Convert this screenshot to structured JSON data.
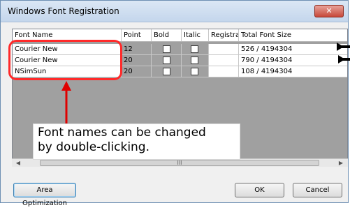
{
  "window": {
    "title": "Windows Font Registration",
    "close_glyph": "✕"
  },
  "table": {
    "headers": [
      "Font Name",
      "Point",
      "Bold",
      "Italic",
      "Registrati",
      "Total Font Size"
    ],
    "rows": [
      {
        "font_name": "Courier New",
        "point": "12",
        "bold": false,
        "italic": false,
        "registration": "",
        "total_font_size": "526 / 4194304"
      },
      {
        "font_name": "Courier New",
        "point": "20",
        "bold": false,
        "italic": false,
        "registration": "",
        "total_font_size": "790 / 4194304"
      },
      {
        "font_name": "NSimSun",
        "point": "20",
        "bold": false,
        "italic": false,
        "registration": "",
        "total_font_size": "108 / 4194304"
      }
    ]
  },
  "scrollbar": {
    "left_arrow": "◀",
    "right_arrow": "▶",
    "thumb_grip": "III"
  },
  "buttons": {
    "area_optimization": "Area Optimization",
    "ok": "OK",
    "cancel": "Cancel"
  },
  "annotation": {
    "text_line1": "Font names can be changed",
    "text_line2": "by double-clicking.",
    "highlight_color": "#ff2a2a",
    "pointer_color": "#e00000"
  },
  "colors": {
    "title_bg": "#c4d6ec",
    "list_bg": "#a0a0a0",
    "close_bg": "#c7483a"
  }
}
